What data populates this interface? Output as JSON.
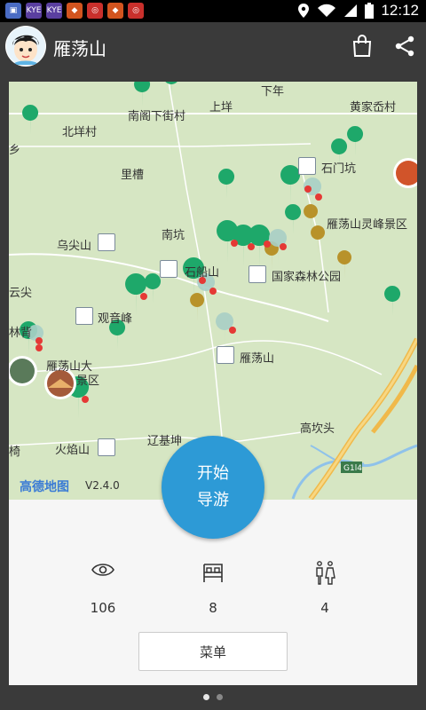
{
  "status_bar": {
    "time": "12:12",
    "apps": [
      "app-icon-1",
      "kye-icon",
      "kye-icon",
      "fox-icon",
      "target-icon",
      "fox-icon",
      "target-icon"
    ]
  },
  "app_bar": {
    "title": "雁荡山",
    "icons": [
      "avatar",
      "shopping-bag-icon",
      "share-icon"
    ]
  },
  "map": {
    "labels": [
      {
        "text": "下年"
      },
      {
        "text": "南阁下街村"
      },
      {
        "text": "上垟"
      },
      {
        "text": "黄家岙村"
      },
      {
        "text": "北垟村"
      },
      {
        "text": "乡"
      },
      {
        "text": "里槽"
      },
      {
        "text": "石门坑"
      },
      {
        "text": "雁荡山灵峰景区"
      },
      {
        "text": "乌尖山"
      },
      {
        "text": "南坑"
      },
      {
        "text": "石船山"
      },
      {
        "text": "国家森林公园"
      },
      {
        "text": "云尖"
      },
      {
        "text": "观音峰"
      },
      {
        "text": "林背"
      },
      {
        "text": "雁荡山"
      },
      {
        "text": "雁荡山大"
      },
      {
        "text": "景区"
      },
      {
        "text": "高坎头"
      },
      {
        "text": "辽基坤"
      },
      {
        "text": "火焰山"
      },
      {
        "text": "椅"
      },
      {
        "text": "G1l4"
      }
    ],
    "provider": "高德地图",
    "version": "V2.4.0"
  },
  "start_button": {
    "line1": "开始",
    "line2": "导游"
  },
  "stats": [
    {
      "icon": "eye-icon",
      "value": "106"
    },
    {
      "icon": "bed-icon",
      "value": "8"
    },
    {
      "icon": "restroom-icon",
      "value": "4"
    }
  ],
  "menu_button": "菜单",
  "pager": {
    "pages": 2,
    "active": 0
  }
}
